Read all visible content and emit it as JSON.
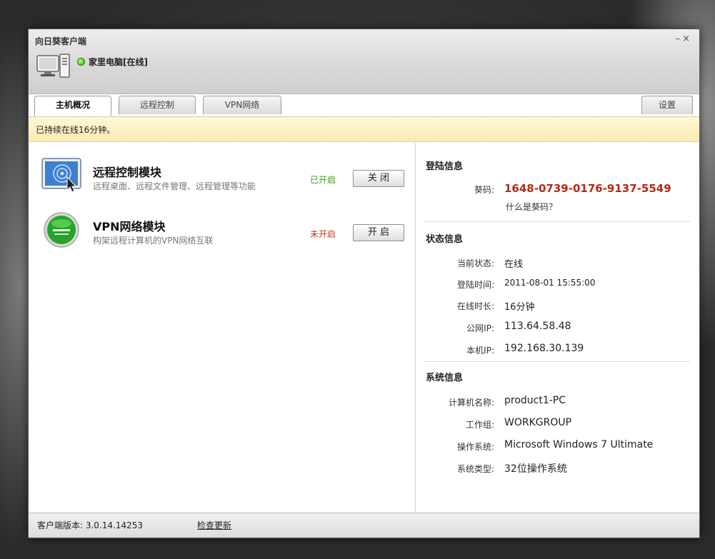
{
  "window": {
    "app_title": "向日葵客户端",
    "controls": {
      "minimize": "–",
      "close": "×"
    }
  },
  "device": {
    "name": "家里电脑[在线]",
    "status_color": "#3aa11c"
  },
  "tabs": [
    {
      "label": "主机概况",
      "active": true
    },
    {
      "label": "远程控制",
      "active": false
    },
    {
      "label": "VPN网络",
      "active": false
    }
  ],
  "settings_tab": {
    "label": "设置"
  },
  "notice": "已持续在线16分钟。",
  "modules": [
    {
      "title": "远程控制模块",
      "desc": "远程桌面、远程文件管理、远程管理等功能",
      "status": "已开启",
      "status_color": "#3a9a16",
      "button": "关 闭",
      "icon": "remote-desktop-icon"
    },
    {
      "title": "VPN网络模块",
      "desc": "构架远程计算机的VPN网络互联",
      "status": "未开启",
      "status_color": "#c0391a",
      "button": "开 启",
      "icon": "vpn-globe-icon"
    }
  ],
  "login_info": {
    "title": "登陆信息",
    "code_label": "葵码:",
    "code_value": "1648-0739-0176-9137-5549",
    "code_help": "什么是葵码？"
  },
  "status_info": {
    "title": "状态信息",
    "rows": [
      {
        "label": "当前状态:",
        "value": "在线"
      },
      {
        "label": "登陆时间:",
        "value": "2011-08-01 15:55:00"
      },
      {
        "label": "在线时长:",
        "value": "16分钟"
      },
      {
        "label": "公网IP:",
        "value": "113.64.58.48"
      },
      {
        "label": "本机IP:",
        "value": "192.168.30.139"
      }
    ]
  },
  "system_info": {
    "title": "系统信息",
    "rows": [
      {
        "label": "计算机名称:",
        "value": "product1-PC"
      },
      {
        "label": "工作组:",
        "value": "WORKGROUP"
      },
      {
        "label": "操作系统:",
        "value": "Microsoft Windows 7 Ultimate"
      },
      {
        "label": "系统类型:",
        "value": "32位操作系统"
      }
    ]
  },
  "footer": {
    "version": "客户端版本: 3.0.14.14253",
    "update_link": "检查更新"
  }
}
